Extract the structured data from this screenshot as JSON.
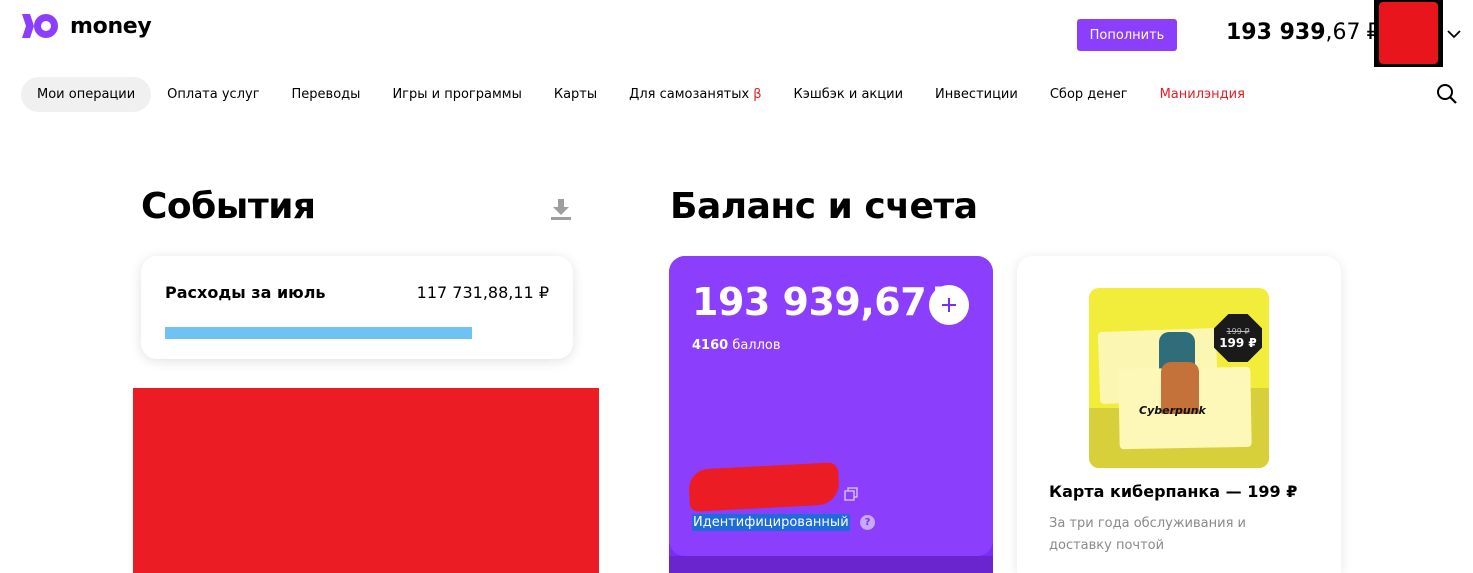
{
  "header": {
    "logo_text": "money",
    "topup_label": "Пополнить",
    "balance_int": "193 939",
    "balance_frac": ",67",
    "balance_currency": "₽"
  },
  "nav": {
    "items": [
      {
        "label": "Мои операции",
        "active": true
      },
      {
        "label": "Оплата услуг"
      },
      {
        "label": "Переводы"
      },
      {
        "label": "Игры и программы"
      },
      {
        "label": "Карты"
      },
      {
        "label": "Для самозанятых",
        "badge": "β"
      },
      {
        "label": "Кэшбэк и акции"
      },
      {
        "label": "Инвестиции"
      },
      {
        "label": "Сбор денег"
      },
      {
        "label": "Манилэндия",
        "color": "#e31e24"
      }
    ]
  },
  "events": {
    "title": "События",
    "expense_label": "Расходы за июль",
    "expense_value": "117 731,88,11 ₽"
  },
  "balance": {
    "title": "Баланс и счета",
    "card_amount": "193 939,67",
    "card_currency": "₽",
    "points_value": "4160",
    "points_label": "баллов",
    "status": "Идентифицированный"
  },
  "promo": {
    "title": "Карта киберпанка — 199 ₽",
    "description": "За три года обслуживания и доставку почтой",
    "badge_old_price": "199 ₽",
    "badge_new_price": "199 ₽",
    "image_text": "Cyberpunk"
  },
  "colors": {
    "accent": "#8b3ffd",
    "expense_bar": "#6ec3f4",
    "promo_bg": "#f2ec3a",
    "red_link": "#e31e24"
  }
}
